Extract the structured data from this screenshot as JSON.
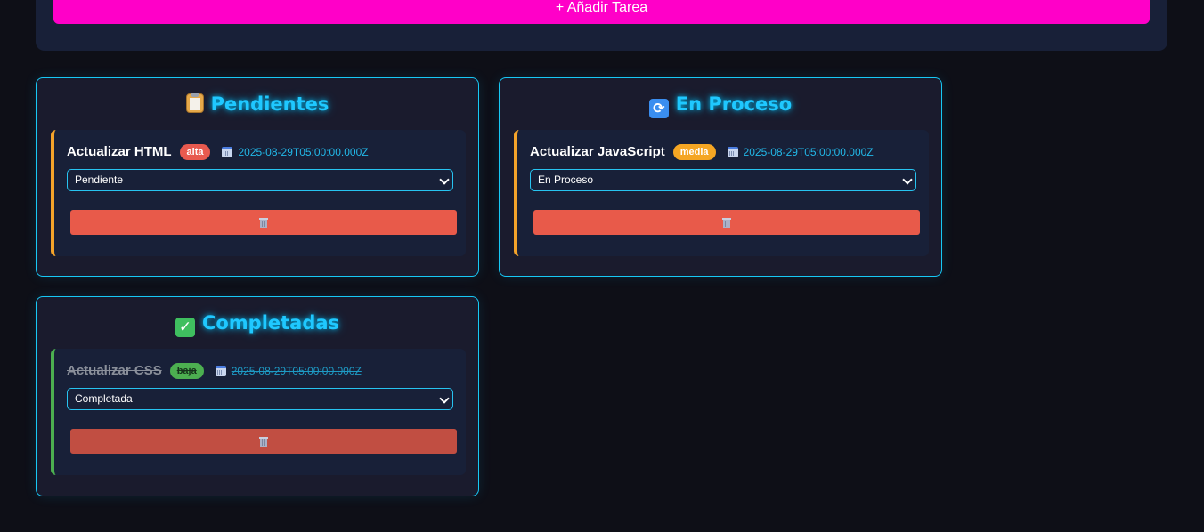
{
  "toolbar": {
    "add_task_label": "+ Añadir Tarea"
  },
  "columns": [
    {
      "title": "Pendientes",
      "icon": "clipboard-icon",
      "tasks": [
        {
          "title": "Actualizar HTML",
          "priority": "alta",
          "date": "2025-08-29T05:00:00.000Z",
          "status": "Pendiente"
        }
      ]
    },
    {
      "title": "En Proceso",
      "icon": "refresh-icon",
      "tasks": [
        {
          "title": "Actualizar JavaScript",
          "priority": "media",
          "date": "2025-08-29T05:00:00.000Z",
          "status": "En Proceso"
        }
      ]
    },
    {
      "title": "Completadas",
      "icon": "check-icon",
      "tasks": [
        {
          "title": "Actualizar CSS",
          "priority": "baja",
          "date": "2025-08-29T05:00:00.000Z",
          "status": "Completada"
        }
      ]
    }
  ],
  "colors": {
    "accent_magenta": "#ff00c8",
    "accent_cyan": "#1fc8ff",
    "priority_high": "#e85a4f",
    "priority_medium": "#f5a623",
    "priority_low": "#4caf50",
    "delete": "#e85a4a"
  }
}
